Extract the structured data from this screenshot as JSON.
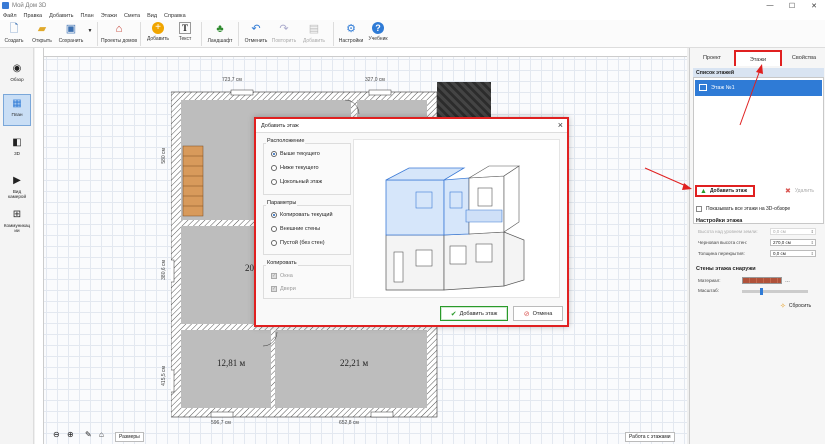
{
  "window": {
    "title": "Мой Дом 3D"
  },
  "menu": [
    "Файл",
    "Правка",
    "Добавить",
    "План",
    "Этажи",
    "Смета",
    "Вид",
    "Справка"
  ],
  "toolbar": [
    {
      "label": "Создать",
      "icon": "new-file-icon",
      "glyph": "🗋"
    },
    {
      "label": "Открыть",
      "icon": "folder-icon",
      "glyph": "📂"
    },
    {
      "label": "Сохранить",
      "icon": "save-icon",
      "glyph": "💾"
    },
    {
      "label": "Проекты домов",
      "icon": "house-projects-icon",
      "glyph": "🏠"
    },
    {
      "label": "Добавить",
      "icon": "add-icon",
      "glyph": "➕"
    },
    {
      "label": "Текст",
      "icon": "text-icon",
      "glyph": "T"
    },
    {
      "label": "Ландшафт",
      "icon": "landscape-icon",
      "glyph": "🌳"
    },
    {
      "label": "Отменить",
      "icon": "undo-icon",
      "glyph": "↶"
    },
    {
      "label": "Повторить",
      "icon": "redo-icon",
      "glyph": "↷",
      "disabled": true
    },
    {
      "label": "Добавить",
      "icon": "paste-icon",
      "glyph": "📋",
      "disabled": true
    },
    {
      "label": "Настройки",
      "icon": "gear-icon",
      "glyph": "⚙"
    },
    {
      "label": "Учебник",
      "icon": "help-icon",
      "glyph": "?"
    }
  ],
  "leftbar": [
    {
      "label": "Обзор",
      "glyph": "👁"
    },
    {
      "label": "План",
      "glyph": "▦",
      "active": true
    },
    {
      "label": "3D",
      "glyph": "◧"
    },
    {
      "label": "Вид камерой",
      "glyph": "🎥"
    },
    {
      "label": "Коммуникации",
      "glyph": "⊞"
    }
  ],
  "plan": {
    "dims": {
      "top1": "723,7 см",
      "top2": "327,0 см",
      "left1": "580 см",
      "left2": "380,6 см",
      "left3": "415,5 см",
      "bottom1": "596,7 см",
      "bottom2": "652,8 см"
    },
    "rooms": {
      "r1": "20,",
      "r2": "12,81 м",
      "r3": "22,21 м"
    }
  },
  "canvas_bottom": {
    "sizes": "Размеры",
    "floors_work": "Работа с этажами"
  },
  "panel": {
    "tabs": [
      "Проект",
      "Этажи",
      "Свойства"
    ],
    "list_title": "Список этажей",
    "floor_item": "Этаж №1",
    "add_floor": "Добавить этаж",
    "delete_floor": "Удалить",
    "show_all": "Показывать все этажи на 3D-обзоре",
    "settings_title": "Настройки этажа",
    "props": [
      {
        "label": "Высота над уровнем земли:",
        "value": "0,0 см",
        "dim": true
      },
      {
        "label": "Черновая высота стен:",
        "value": "270,0 см"
      },
      {
        "label": "Толщина перекрытия:",
        "value": "0,0 см"
      }
    ],
    "walls_title": "Стены этажа снаружи",
    "material_label": "Материал:",
    "scale_label": "Масштаб:",
    "reset": "Сбросить"
  },
  "dialog": {
    "title": "Добавить этаж",
    "location_title": "Расположение",
    "location_opts": [
      "Выше текущего",
      "Ниже текущего",
      "Цокольный этаж"
    ],
    "params_title": "Параметры",
    "params_opts": [
      "Копировать текущий",
      "Внешние стены",
      "Пустой (без стен)"
    ],
    "copy_title": "Копировать",
    "copy_opts": [
      "Окна",
      "Двери"
    ],
    "ok": "Добавить этаж",
    "cancel": "Отмена"
  }
}
